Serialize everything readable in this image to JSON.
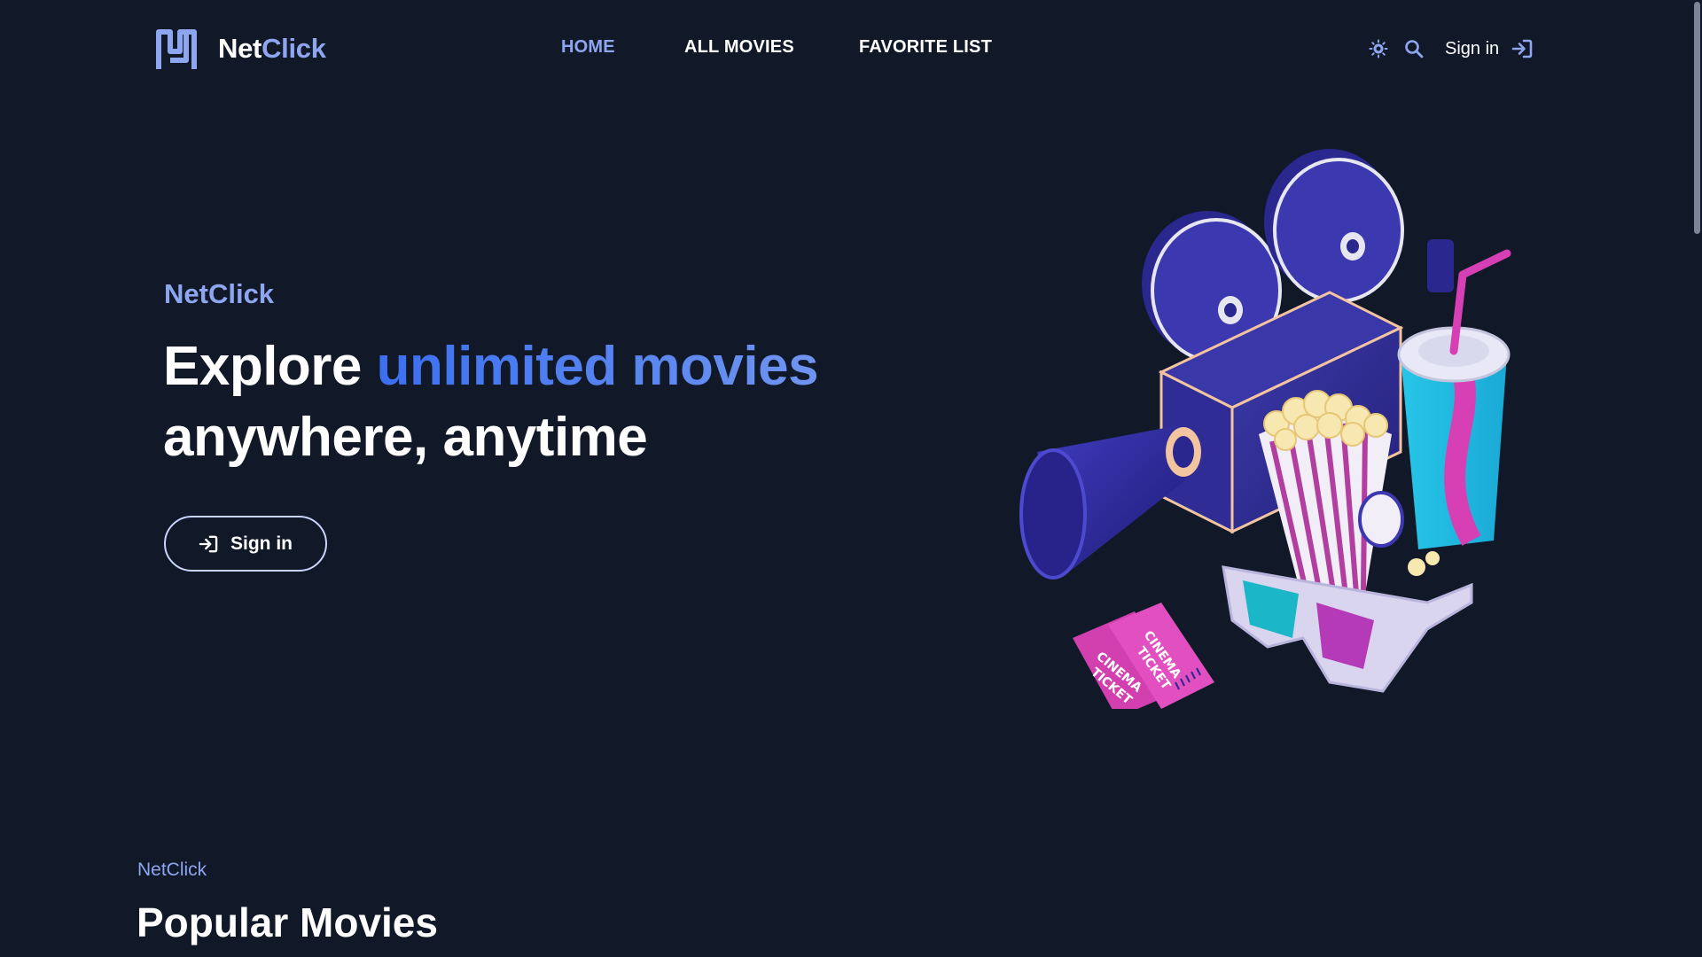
{
  "header": {
    "brand": {
      "part1": "Net",
      "part2": "Click"
    },
    "nav": [
      {
        "label": "HOME",
        "active": true
      },
      {
        "label": "ALL MOVIES",
        "active": false
      },
      {
        "label": "FAVORITE LIST",
        "active": false
      }
    ],
    "actions": {
      "theme_icon": "sun-icon",
      "search_icon": "search-icon",
      "signin_label": "Sign in",
      "signin_icon": "sign-in-icon"
    }
  },
  "hero": {
    "eyebrow": "NetClick",
    "title_part1": "Explore ",
    "title_accent": "unlimited movies",
    "title_line2": "anywhere, anytime",
    "signin_label": "Sign in",
    "illustration": "cinema-illustration"
  },
  "popular": {
    "eyebrow": "NetClick",
    "title": "Popular Movies"
  },
  "colors": {
    "background": "#111827",
    "accent": "#8ea6f0",
    "accent_gradient_start": "#3b6ff0",
    "accent_gradient_end": "#6f95f0",
    "text": "#ffffff"
  }
}
